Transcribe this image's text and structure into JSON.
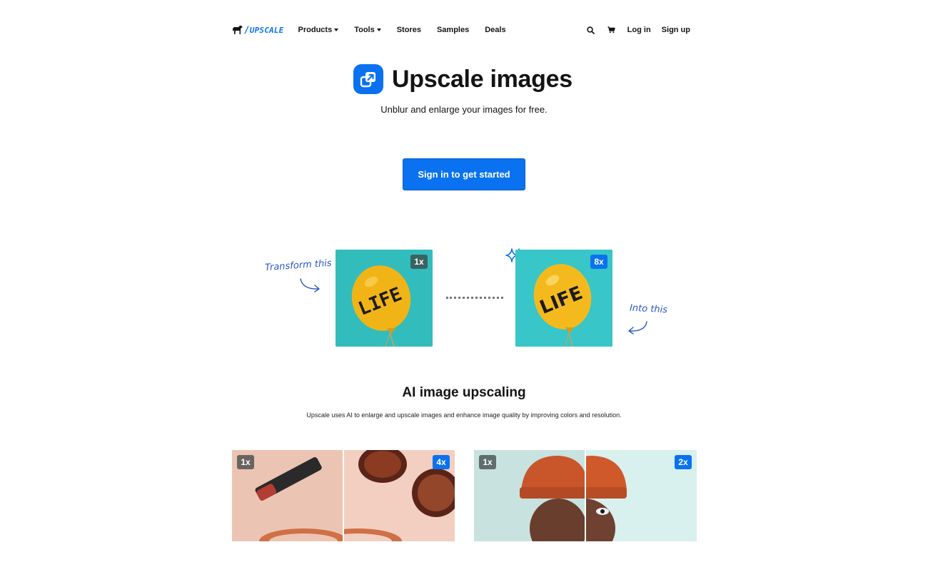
{
  "nav": {
    "logo_text": "UPSCALE",
    "items": [
      {
        "label": "Products",
        "dropdown": true
      },
      {
        "label": "Tools",
        "dropdown": true
      },
      {
        "label": "Stores",
        "dropdown": false
      },
      {
        "label": "Samples",
        "dropdown": false
      },
      {
        "label": "Deals",
        "dropdown": false
      }
    ],
    "search_icon": "search-icon",
    "cart_icon": "cart-icon",
    "login_label": "Log in",
    "signup_label": "Sign up"
  },
  "hero": {
    "title": "Upscale images",
    "subtitle": "Unblur and enlarge your images for free.",
    "cta_label": "Sign in to get started",
    "app_icon": "upscale-arrow-icon"
  },
  "demo": {
    "left_note": "Transform this",
    "right_note": "Into this",
    "before_badge": "1x",
    "after_badge": "8x",
    "balloon_text": "LIFE",
    "sparkle_icon": "sparkle-icon"
  },
  "section": {
    "title": "AI image upscaling",
    "subtitle": "Upscale uses AI to enlarge and upscale images and enhance image quality by improving colors and resolution."
  },
  "comparisons": [
    {
      "before_badge": "1x",
      "after_badge": "4x",
      "subject": "sunglasses-and-lipstick"
    },
    {
      "before_badge": "1x",
      "after_badge": "2x",
      "subject": "man-in-orange-beanie"
    }
  ],
  "colors": {
    "accent": "#0a72f0",
    "text": "#141414",
    "balloon_bg": "#35c2c2",
    "balloon": "#f2b81f",
    "handwriting": "#2b56c8"
  }
}
